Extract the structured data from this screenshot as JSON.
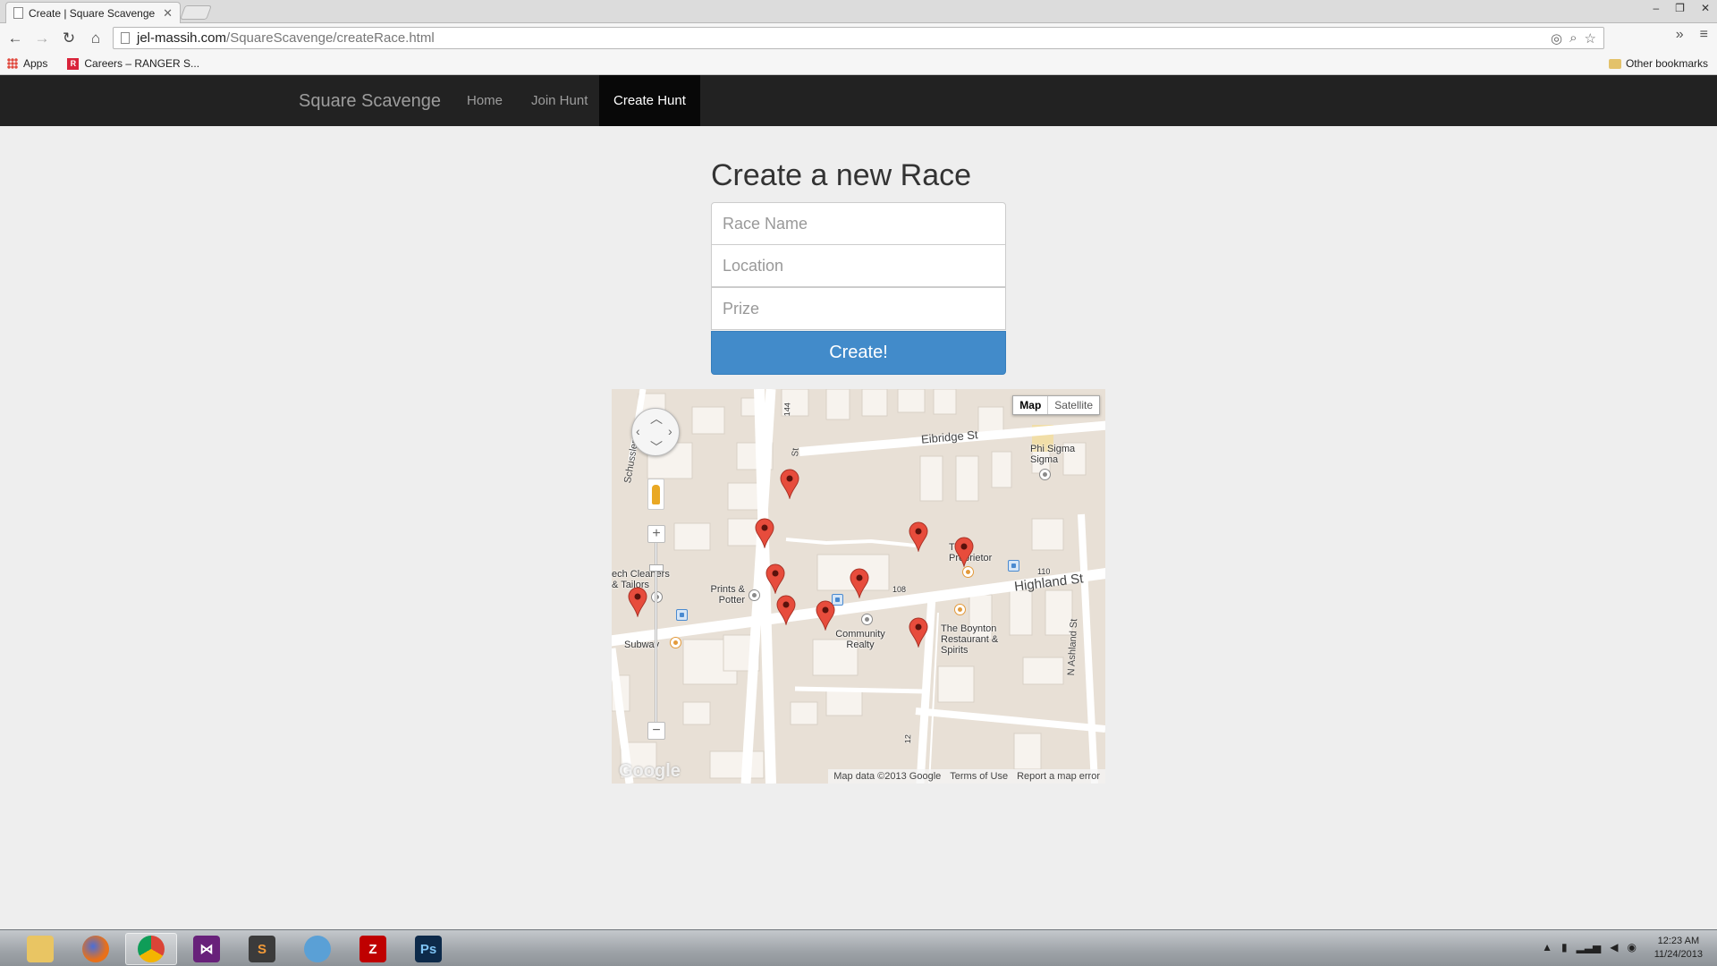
{
  "browser": {
    "tab_title": "Create | Square Scavenge",
    "url_host": "jel-massih.com",
    "url_path": "/SquareScavenge/createRace.html",
    "bookmarks": [
      {
        "label": "Apps"
      },
      {
        "label": "Careers – RANGER S..."
      }
    ],
    "other_bookmarks": "Other bookmarks"
  },
  "site": {
    "brand": "Square Scavenge",
    "nav": [
      {
        "label": "Home",
        "active": false
      },
      {
        "label": "Join Hunt",
        "active": false
      },
      {
        "label": "Create Hunt",
        "active": true
      }
    ]
  },
  "form": {
    "heading": "Create a new Race",
    "race_name_placeholder": "Race Name",
    "location_placeholder": "Location",
    "prize_placeholder": "Prize",
    "submit_label": "Create!"
  },
  "map": {
    "type_map": "Map",
    "type_satellite": "Satellite",
    "streets": [
      "Eibridge St",
      "Highland St",
      "N Ashland St",
      "Schussler Rd",
      "St"
    ],
    "street_numbers": [
      "144",
      "108",
      "110",
      "12"
    ],
    "places": [
      "Phi Sigma Sigma",
      "The Proprietor",
      "ech Cleaners & Tailors",
      "Prints & Potter",
      "Community Realty",
      "The Boynton Restaurant & Spirits",
      "Subway"
    ],
    "marker_count": 10,
    "attribution": "Map data ©2013 Google",
    "terms": "Terms of Use",
    "report": "Report a map error",
    "logo": "Google"
  },
  "taskbar": {
    "apps": [
      "file-explorer-icon",
      "firefox-icon",
      "chrome-icon",
      "visual-studio-icon",
      "sublime-text-icon",
      "app-icon",
      "filezilla-icon",
      "photoshop-icon"
    ],
    "time": "12:23 AM",
    "date": "11/24/2013"
  },
  "colors": {
    "navbar": "#222222",
    "primary_button": "#428bca",
    "marker": "#e74c3c"
  }
}
